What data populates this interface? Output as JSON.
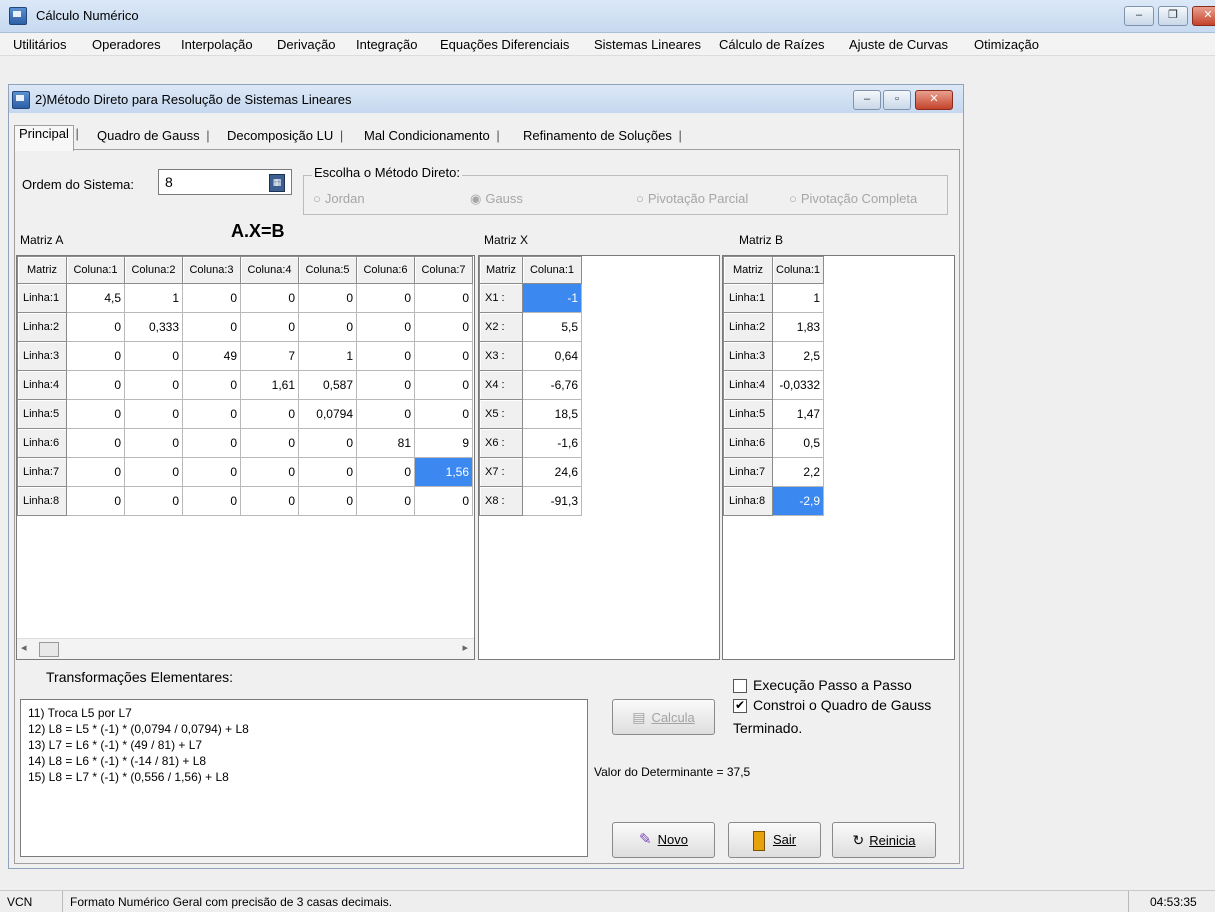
{
  "app_title": "Cálculo Numérico",
  "menu": [
    "Utilitários",
    "Operadores",
    "Interpolação",
    "Derivação",
    "Integração",
    "Equações Diferenciais",
    "Sistemas Lineares",
    "Cálculo de Raízes",
    "Ajuste de Curvas",
    "Otimização"
  ],
  "child_title": "2)Método Direto para Resolução de Sistemas Lineares",
  "tabs": [
    "Principal",
    "Quadro de Gauss",
    "Decomposição LU",
    "Mal Condicionamento",
    "Refinamento de Soluções"
  ],
  "ordem_label": "Ordem do Sistema:",
  "ordem_value": "8",
  "metodo_label": "Escolha o Método Direto:",
  "metodos": [
    "Jordan",
    "Gauss",
    "Pivotação Parcial",
    "Pivotação Completa"
  ],
  "metodo_selected": "Gauss",
  "equation": "A.X=B",
  "matriz_a_label": "Matriz A",
  "matriz_x_label": "Matriz X",
  "matriz_b_label": "Matriz B",
  "matriz_a": {
    "corner": "Matriz",
    "columns": [
      "Coluna:1",
      "Coluna:2",
      "Coluna:3",
      "Coluna:4",
      "Coluna:5",
      "Coluna:6",
      "Coluna:7"
    ],
    "rows": [
      {
        "label": "Linha:1",
        "values": [
          "4,5",
          "1",
          "0",
          "0",
          "0",
          "0",
          "0"
        ]
      },
      {
        "label": "Linha:2",
        "values": [
          "0",
          "0,333",
          "0",
          "0",
          "0",
          "0",
          "0"
        ]
      },
      {
        "label": "Linha:3",
        "values": [
          "0",
          "0",
          "49",
          "7",
          "1",
          "0",
          "0"
        ]
      },
      {
        "label": "Linha:4",
        "values": [
          "0",
          "0",
          "0",
          "1,61",
          "0,587",
          "0",
          "0"
        ]
      },
      {
        "label": "Linha:5",
        "values": [
          "0",
          "0",
          "0",
          "0",
          "0,0794",
          "0",
          "0"
        ]
      },
      {
        "label": "Linha:6",
        "values": [
          "0",
          "0",
          "0",
          "0",
          "0",
          "81",
          "9"
        ]
      },
      {
        "label": "Linha:7",
        "values": [
          "0",
          "0",
          "0",
          "0",
          "0",
          "0",
          "1,56"
        ]
      },
      {
        "label": "Linha:8",
        "values": [
          "0",
          "0",
          "0",
          "0",
          "0",
          "0",
          "0"
        ]
      }
    ]
  },
  "matriz_x": {
    "corner": "Matriz",
    "column": "Coluna:1",
    "rows": [
      {
        "label": "X1 :",
        "value": "-1"
      },
      {
        "label": "X2 :",
        "value": "5,5"
      },
      {
        "label": "X3 :",
        "value": "0,64"
      },
      {
        "label": "X4 :",
        "value": "-6,76"
      },
      {
        "label": "X5 :",
        "value": "18,5"
      },
      {
        "label": "X6 :",
        "value": "-1,6"
      },
      {
        "label": "X7 :",
        "value": "24,6"
      },
      {
        "label": "X8 :",
        "value": "-91,3"
      }
    ]
  },
  "matriz_b": {
    "corner": "Matriz",
    "column": "Coluna:1",
    "rows": [
      {
        "label": "Linha:1",
        "value": "1"
      },
      {
        "label": "Linha:2",
        "value": "1,83"
      },
      {
        "label": "Linha:3",
        "value": "2,5"
      },
      {
        "label": "Linha:4",
        "value": "-0,0332"
      },
      {
        "label": "Linha:5",
        "value": "1,47"
      },
      {
        "label": "Linha:6",
        "value": "0,5"
      },
      {
        "label": "Linha:7",
        "value": "2,2"
      },
      {
        "label": "Linha:8",
        "value": "-2,9"
      }
    ]
  },
  "transformacoes_label": "Transformações Elementares:",
  "transformacoes": [
    "11) Troca L5 por  L7",
    "12) L8 = L5 * (-1) * (0,0794 / 0,0794) + L8",
    "13) L7 = L6 * (-1) * (49 / 81) + L7",
    "14) L8 = L6 * (-1) * (-14 / 81) + L8",
    "15) L8 = L7 * (-1) * (0,556 / 1,56) + L8"
  ],
  "passo_label": "Execução Passo a Passo",
  "passo_checked": false,
  "quadro_label": "Constroi o Quadro de Gauss",
  "quadro_checked": true,
  "terminado": "Terminado.",
  "determinante": "Valor do Determinante = 37,5",
  "calcula_label": "Calcula",
  "novo_label": "Novo",
  "sair_label": "Sair",
  "reinicia_label": "Reinicia",
  "status_left": "VCN",
  "status_text": "Formato Numérico Geral com precisão de 3 casas decimais.",
  "status_time": "04:53:35",
  "selection_color": "#3b88f0"
}
